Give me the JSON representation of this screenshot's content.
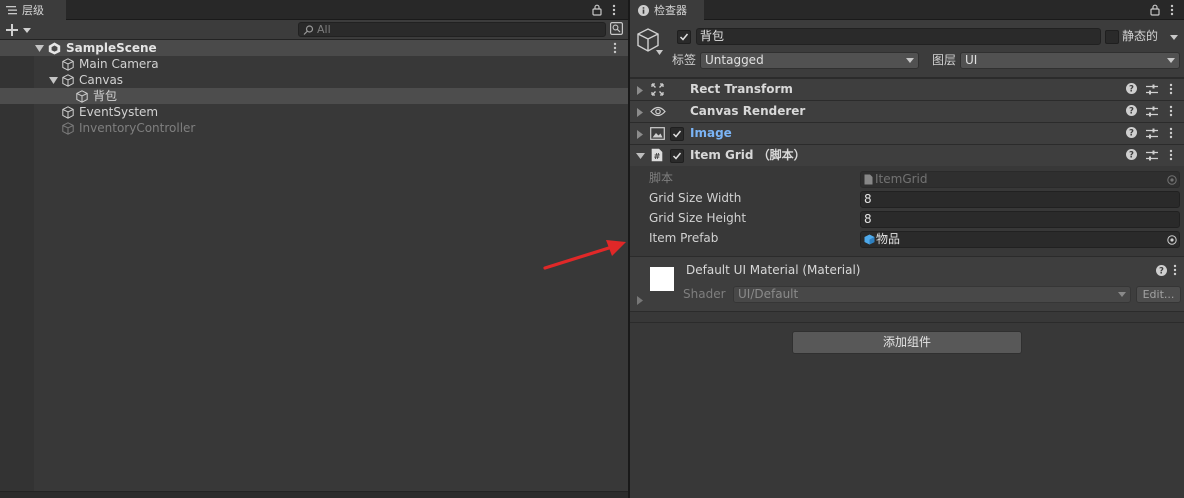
{
  "hierarchy": {
    "tab_label": "层级",
    "search_placeholder": "All",
    "scene_name": "SampleScene",
    "items": [
      {
        "label": "Main Camera",
        "active": true
      },
      {
        "label": "Canvas",
        "active": true
      },
      {
        "label": "背包",
        "active": true
      },
      {
        "label": "EventSystem",
        "active": true
      },
      {
        "label": "InventoryController",
        "active": false
      }
    ]
  },
  "inspector": {
    "tab_label": "检查器",
    "object_name": "背包",
    "static_label": "静态的",
    "tag_label": "标签",
    "tag_value": "Untagged",
    "layer_label": "图层",
    "layer_value": "UI",
    "components": [
      {
        "name": "Rect Transform",
        "icon": "rect-transform-icon"
      },
      {
        "name": "Canvas Renderer",
        "icon": "eye-icon"
      },
      {
        "name": "Image",
        "icon": "image-icon",
        "enabled": true
      },
      {
        "name": "Item Grid （脚本）",
        "icon": "script-icon",
        "enabled": true,
        "expanded": true
      }
    ],
    "item_grid": {
      "script_label": "脚本",
      "script_value": "ItemGrid",
      "width_label": "Grid Size Width",
      "width_value": "8",
      "height_label": "Grid Size Height",
      "height_value": "8",
      "prefab_label": "Item Prefab",
      "prefab_value": "物品"
    },
    "material": {
      "name": "Default UI Material (Material)",
      "shader_label": "Shader",
      "shader_value": "UI/Default",
      "edit_label": "Edit..."
    },
    "add_component_label": "添加组件"
  },
  "colors": {
    "panel_bg": "#383838",
    "selection_bg": "#4d4d4d",
    "component_header_bg": "#3e3e3e",
    "field_bg": "#2a2a2a",
    "image_title": "#7bb4f5",
    "annotation_arrow": "#e02828"
  }
}
